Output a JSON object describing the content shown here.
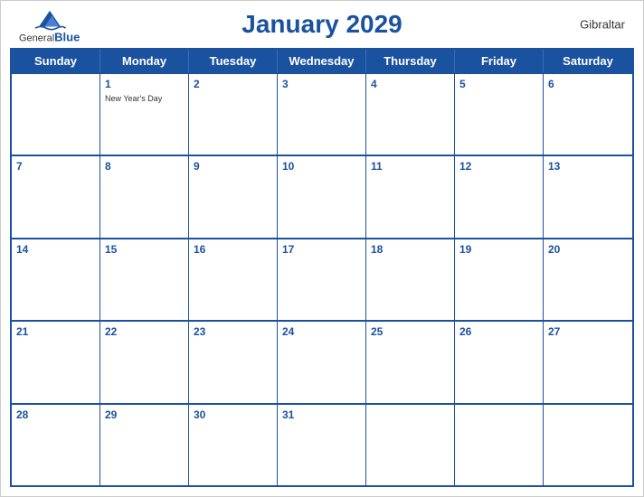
{
  "header": {
    "title": "January 2029",
    "logo_general": "General",
    "logo_blue": "Blue",
    "region": "Gibraltar"
  },
  "days_of_week": [
    "Sunday",
    "Monday",
    "Tuesday",
    "Wednesday",
    "Thursday",
    "Friday",
    "Saturday"
  ],
  "weeks": [
    [
      {
        "num": "",
        "event": ""
      },
      {
        "num": "1",
        "event": "New Year's Day"
      },
      {
        "num": "2",
        "event": ""
      },
      {
        "num": "3",
        "event": ""
      },
      {
        "num": "4",
        "event": ""
      },
      {
        "num": "5",
        "event": ""
      },
      {
        "num": "6",
        "event": ""
      }
    ],
    [
      {
        "num": "7",
        "event": ""
      },
      {
        "num": "8",
        "event": ""
      },
      {
        "num": "9",
        "event": ""
      },
      {
        "num": "10",
        "event": ""
      },
      {
        "num": "11",
        "event": ""
      },
      {
        "num": "12",
        "event": ""
      },
      {
        "num": "13",
        "event": ""
      }
    ],
    [
      {
        "num": "14",
        "event": ""
      },
      {
        "num": "15",
        "event": ""
      },
      {
        "num": "16",
        "event": ""
      },
      {
        "num": "17",
        "event": ""
      },
      {
        "num": "18",
        "event": ""
      },
      {
        "num": "19",
        "event": ""
      },
      {
        "num": "20",
        "event": ""
      }
    ],
    [
      {
        "num": "21",
        "event": ""
      },
      {
        "num": "22",
        "event": ""
      },
      {
        "num": "23",
        "event": ""
      },
      {
        "num": "24",
        "event": ""
      },
      {
        "num": "25",
        "event": ""
      },
      {
        "num": "26",
        "event": ""
      },
      {
        "num": "27",
        "event": ""
      }
    ],
    [
      {
        "num": "28",
        "event": ""
      },
      {
        "num": "29",
        "event": ""
      },
      {
        "num": "30",
        "event": ""
      },
      {
        "num": "31",
        "event": ""
      },
      {
        "num": "",
        "event": ""
      },
      {
        "num": "",
        "event": ""
      },
      {
        "num": "",
        "event": ""
      }
    ]
  ],
  "colors": {
    "primary": "#1a52a0",
    "header_text": "#ffffff",
    "cell_bg": "#ffffff"
  }
}
